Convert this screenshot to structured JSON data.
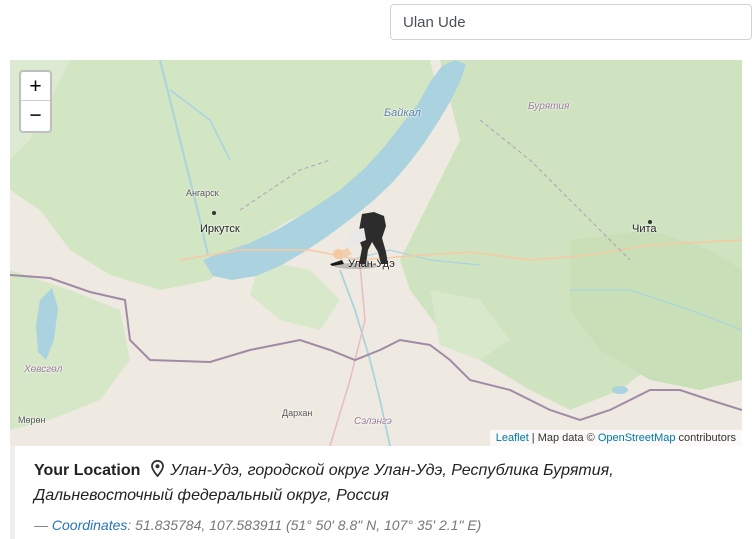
{
  "search": {
    "value": "Ulan Ude"
  },
  "map": {
    "zoom_in": "+",
    "zoom_out": "−",
    "labels": {
      "baikal": "Байкал",
      "buryatia": "Бурятия",
      "angarsk": "Ангарск",
      "irkutsk": "Иркутск",
      "ulan_ude": "Улан-Удэ",
      "chita": "Чита",
      "khovsgol": "Хөвсгөл",
      "moron": "Мөрөн",
      "darkhan": "Дархан",
      "selenge": "Сэлэнгэ"
    },
    "attribution": {
      "leaflet": "Leaflet",
      "sep": " | Map data © ",
      "osm": "OpenStreetMap",
      "suffix": " contributors"
    },
    "colors": {
      "land": "#efeae1",
      "forest": "#cfe3c0",
      "water": "#aad3df",
      "border": "#a08aa6"
    }
  },
  "location": {
    "title": "Your Location",
    "address": "Улан-Удэ, городской округ Улан-Удэ, Республика Бурятия, Дальневосточный федеральный округ, Россия",
    "dash": "— ",
    "coords_label": "Coordinates",
    "coords_value": ": 51.835784, 107.583911 (51° 50' 8.8\" N, 107° 35' 2.1\" E)"
  }
}
